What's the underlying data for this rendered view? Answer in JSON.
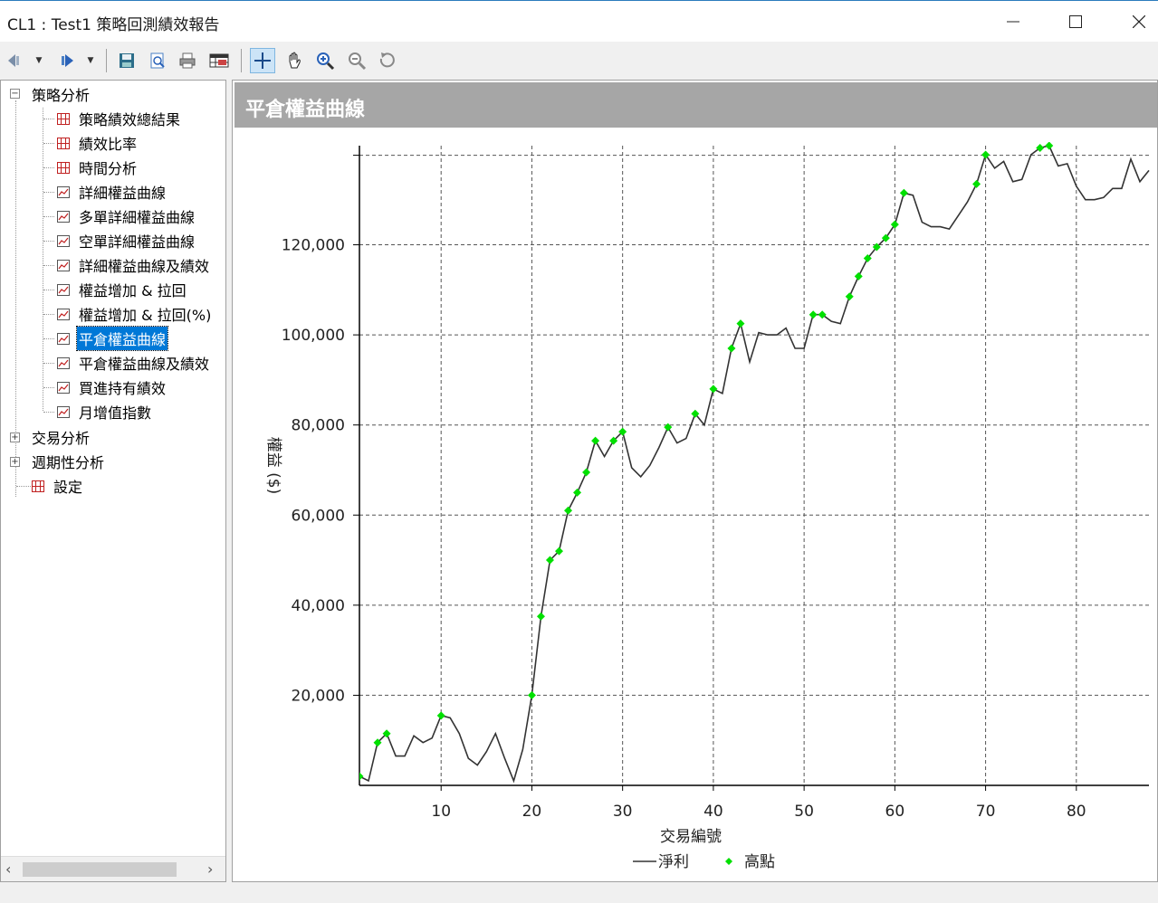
{
  "window": {
    "title": "CL1 : Test1 策略回測績效報告",
    "minimize": "—",
    "maximize": "☐",
    "close": "✕"
  },
  "toolbar": {
    "icons": [
      "back-icon",
      "forward-icon",
      "save-icon",
      "preview-icon",
      "print-icon",
      "table-icon",
      "crosshair-icon",
      "hand-icon",
      "zoom-in-icon",
      "zoom-out-icon",
      "reset-icon"
    ]
  },
  "tree": {
    "root_strategy": "策略分析",
    "strategy_items": [
      {
        "label": "策略績效總結果",
        "icon": "grid"
      },
      {
        "label": "績效比率",
        "icon": "grid"
      },
      {
        "label": "時間分析",
        "icon": "grid"
      },
      {
        "label": "詳細權益曲線",
        "icon": "chart"
      },
      {
        "label": "多單詳細權益曲線",
        "icon": "chart"
      },
      {
        "label": "空單詳細權益曲線",
        "icon": "chart"
      },
      {
        "label": "詳細權益曲線及績效",
        "icon": "chart"
      },
      {
        "label": "權益增加 & 拉回",
        "icon": "chart"
      },
      {
        "label": "權益增加 & 拉回(%)",
        "icon": "chart"
      },
      {
        "label": "平倉權益曲線",
        "icon": "chart",
        "selected": true
      },
      {
        "label": "平倉權益曲線及績效",
        "icon": "chart"
      },
      {
        "label": "買進持有績效",
        "icon": "chart"
      },
      {
        "label": "月增值指數",
        "icon": "chart"
      }
    ],
    "root_trade": "交易分析",
    "root_period": "週期性分析",
    "root_settings": "設定"
  },
  "panel": {
    "header": "平倉權益曲線"
  },
  "chart_data": {
    "type": "line",
    "title": "",
    "xlabel": "交易編號",
    "ylabel": "權益 ($)",
    "xlim": [
      1,
      88
    ],
    "ylim": [
      0,
      142000
    ],
    "xticks": [
      10,
      20,
      30,
      40,
      50,
      60,
      70,
      80
    ],
    "yticks": [
      20000,
      40000,
      60000,
      80000,
      100000,
      120000
    ],
    "ytick_labels": [
      "20,000",
      "40,000",
      "60,000",
      "80,000",
      "100,000",
      "120,000"
    ],
    "grid": true,
    "legend": {
      "placement": "bottom-center",
      "line_label": "淨利",
      "marker_label": "高點"
    },
    "colors": {
      "line": "#333333",
      "marker": "#00e000"
    },
    "series": [
      {
        "name": "淨利",
        "x": [
          1,
          2,
          3,
          4,
          5,
          6,
          7,
          8,
          9,
          10,
          11,
          12,
          13,
          14,
          15,
          16,
          17,
          18,
          19,
          20,
          21,
          22,
          23,
          24,
          25,
          26,
          27,
          28,
          29,
          30,
          31,
          32,
          33,
          34,
          35,
          36,
          37,
          38,
          39,
          40,
          41,
          42,
          43,
          44,
          45,
          46,
          47,
          48,
          49,
          50,
          51,
          52,
          53,
          54,
          55,
          56,
          57,
          58,
          59,
          60,
          61,
          62,
          63,
          64,
          65,
          66,
          67,
          68,
          69,
          70,
          71,
          72,
          73,
          74,
          75,
          76,
          77,
          78,
          79,
          80,
          81,
          82,
          83,
          84,
          85,
          86,
          87,
          88
        ],
        "y": [
          2000,
          1000,
          9500,
          11500,
          6500,
          6500,
          11000,
          9500,
          10500,
          15500,
          15000,
          11500,
          6000,
          4500,
          7500,
          11500,
          6000,
          1000,
          8000,
          20000,
          37500,
          50000,
          52000,
          61000,
          65000,
          69500,
          76500,
          73000,
          76500,
          78500,
          70500,
          68500,
          71000,
          75000,
          79500,
          76000,
          77000,
          82500,
          80000,
          88000,
          87000,
          97000,
          102500,
          94000,
          100500,
          100000,
          100000,
          101500,
          97000,
          97000,
          104500,
          104500,
          103000,
          102500,
          108500,
          113000,
          117000,
          119500,
          121500,
          124500,
          131500,
          131000,
          125000,
          124000,
          124000,
          123500,
          126500,
          129500,
          133500,
          140000,
          137000,
          138500,
          134000,
          134500,
          140000,
          141500,
          142000,
          137500,
          138000,
          133000,
          130000,
          130000,
          130500,
          132500,
          132500,
          139000,
          134000,
          136500
        ]
      },
      {
        "name": "高點",
        "x": [
          1,
          3,
          4,
          10,
          20,
          21,
          22,
          23,
          24,
          25,
          26,
          27,
          29,
          30,
          35,
          38,
          40,
          42,
          43,
          51,
          52,
          55,
          56,
          57,
          58,
          59,
          60,
          61,
          69,
          70,
          76,
          77
        ],
        "y": [
          2000,
          9500,
          11500,
          15500,
          20000,
          37500,
          50000,
          52000,
          61000,
          65000,
          69500,
          76500,
          76500,
          78500,
          79500,
          82500,
          88000,
          97000,
          102500,
          104500,
          104500,
          108500,
          113000,
          117000,
          119500,
          121500,
          124500,
          131500,
          133500,
          140000,
          141500,
          142000
        ]
      }
    ]
  }
}
